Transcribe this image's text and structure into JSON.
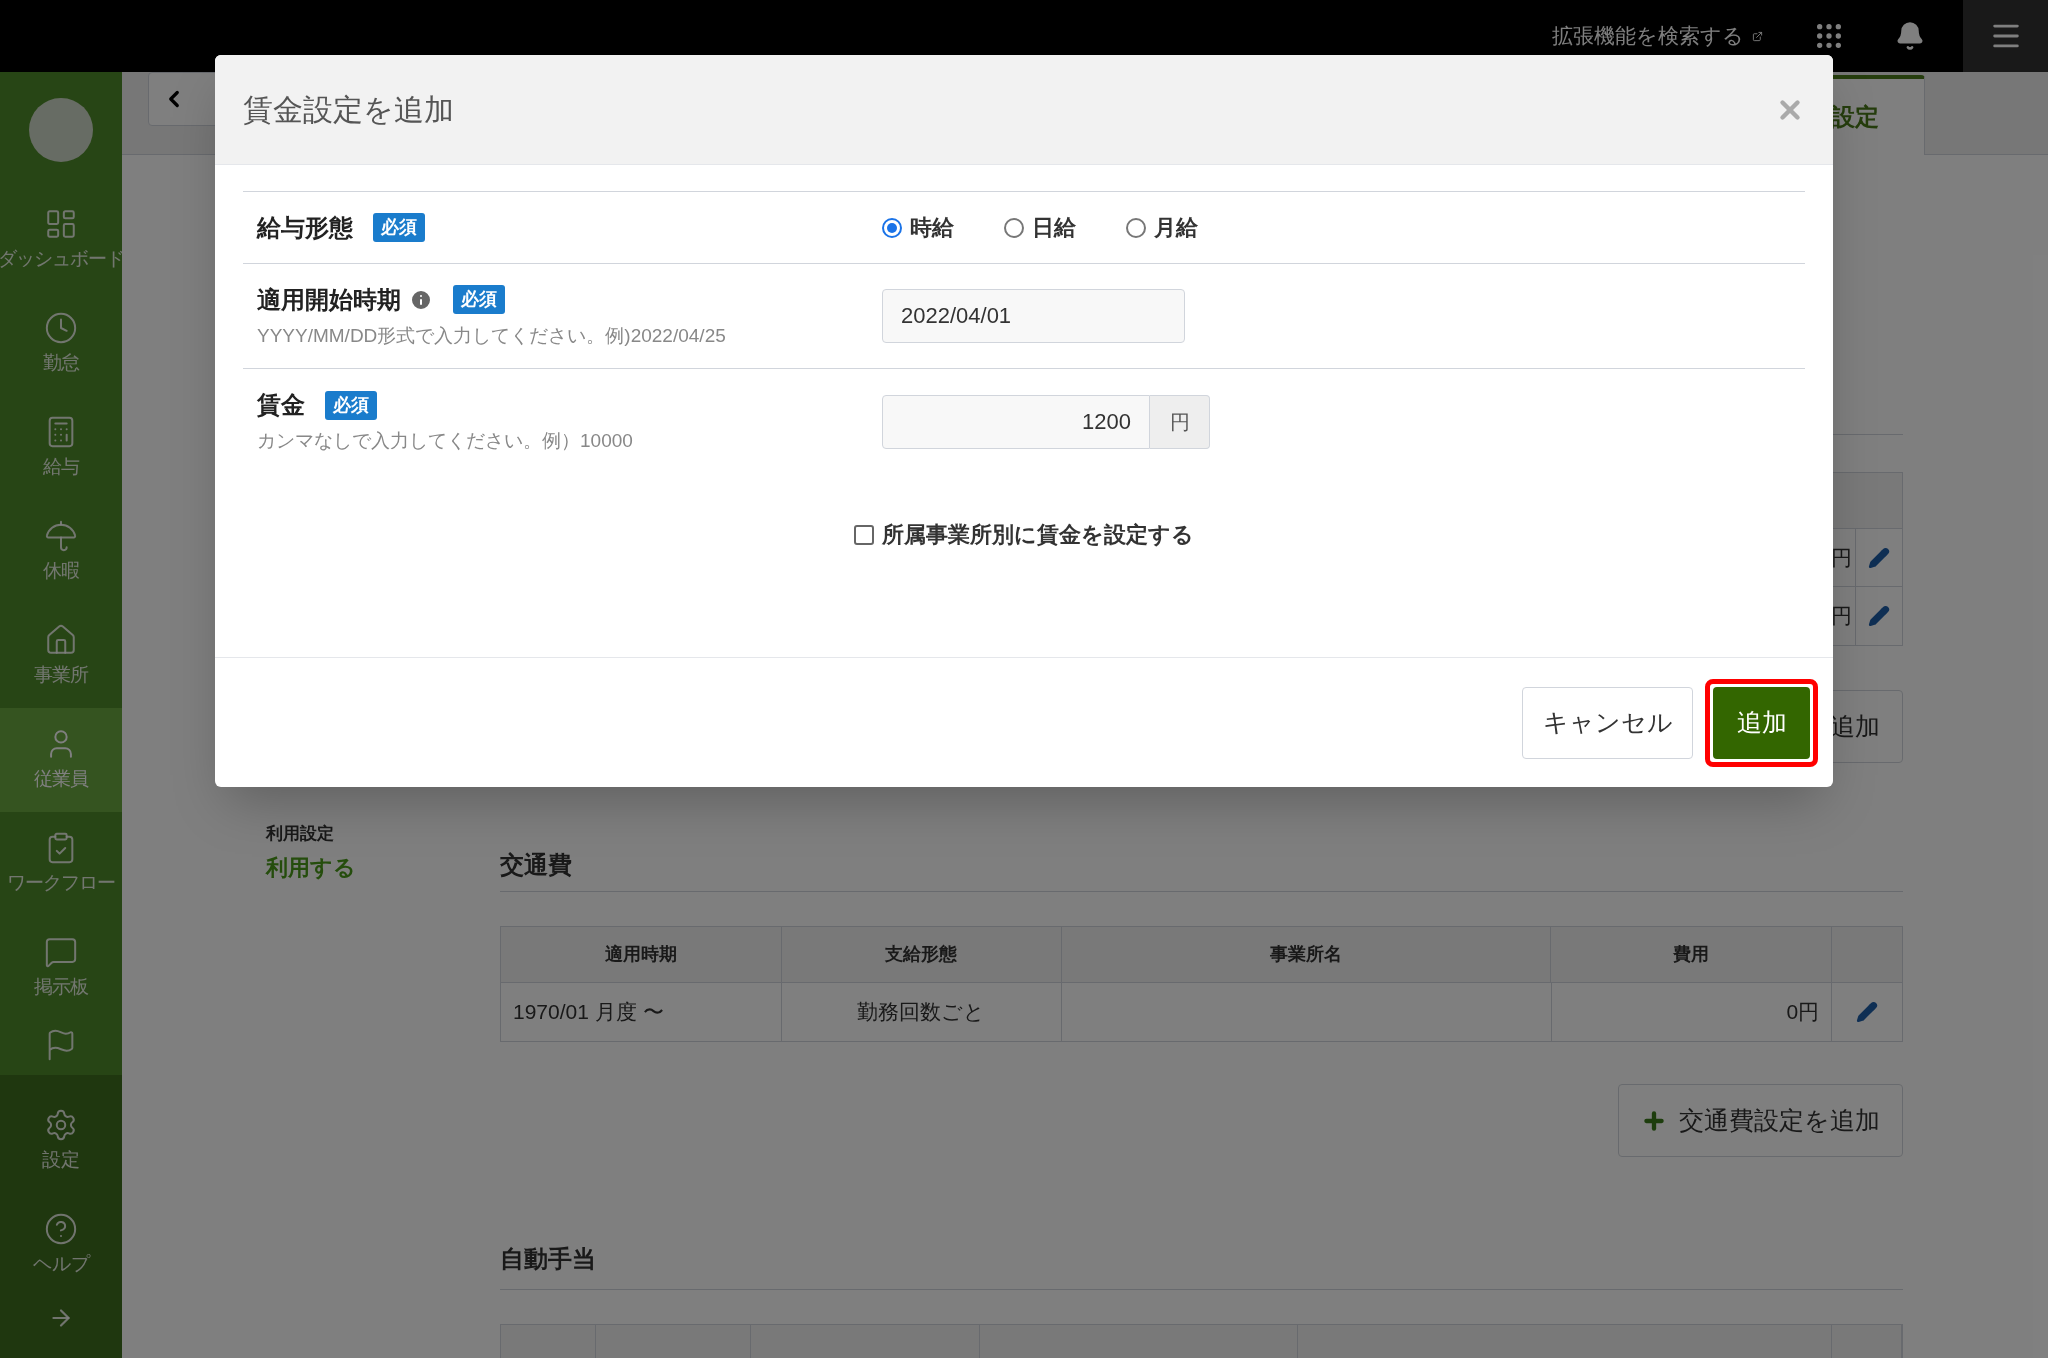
{
  "top_bar": {
    "search_link": "拡張機能を検索する"
  },
  "sidebar": {
    "items": [
      {
        "label": "ダッシュボード",
        "selected": false
      },
      {
        "label": "勤怠",
        "selected": false
      },
      {
        "label": "給与",
        "selected": false
      },
      {
        "label": "休暇",
        "selected": false
      },
      {
        "label": "事業所",
        "selected": false
      },
      {
        "label": "従業員",
        "selected": true
      },
      {
        "label": "ワークフロー",
        "selected": false
      },
      {
        "label": "掲示板",
        "selected": false
      }
    ],
    "bottom_items": [
      {
        "label": "設定"
      },
      {
        "label": "ヘルプ"
      }
    ]
  },
  "page": {
    "tab": "設定",
    "upper_table": {
      "rows": [
        {
          "amount": "円"
        },
        {
          "amount": "円"
        }
      ]
    },
    "upper_add_button": "追加",
    "usage": {
      "label": "利用設定",
      "value": "利用する"
    },
    "transport": {
      "title": "交通費",
      "columns": [
        "適用時期",
        "支給形態",
        "事業所名",
        "費用"
      ],
      "rows": [
        [
          "1970/01 月度 〜",
          "勤務回数ごと",
          "",
          "0円"
        ]
      ],
      "add_button": "交通費設定を追加"
    },
    "auto_allowance": {
      "title": "自動手当"
    }
  },
  "dialog": {
    "title": "賃金設定を追加",
    "pay_type": {
      "label": "給与形態",
      "badge": "必須",
      "options": [
        {
          "label": "時給",
          "selected": true
        },
        {
          "label": "日給",
          "selected": false
        },
        {
          "label": "月給",
          "selected": false
        }
      ]
    },
    "start_date": {
      "label": "適用開始時期",
      "badge": "必須",
      "hint": "YYYY/MM/DD形式で入力してください。例)2022/04/25",
      "value": "2022/04/01"
    },
    "wage": {
      "label": "賃金",
      "badge": "必須",
      "hint": "カンマなしで入力してください。例）10000",
      "value": "1200",
      "unit": "円"
    },
    "per_office": {
      "label": "所属事業所別に賃金を設定する",
      "checked": false
    },
    "buttons": {
      "cancel": "キャンセル",
      "submit": "追加"
    },
    "submit_highlighted": true
  }
}
